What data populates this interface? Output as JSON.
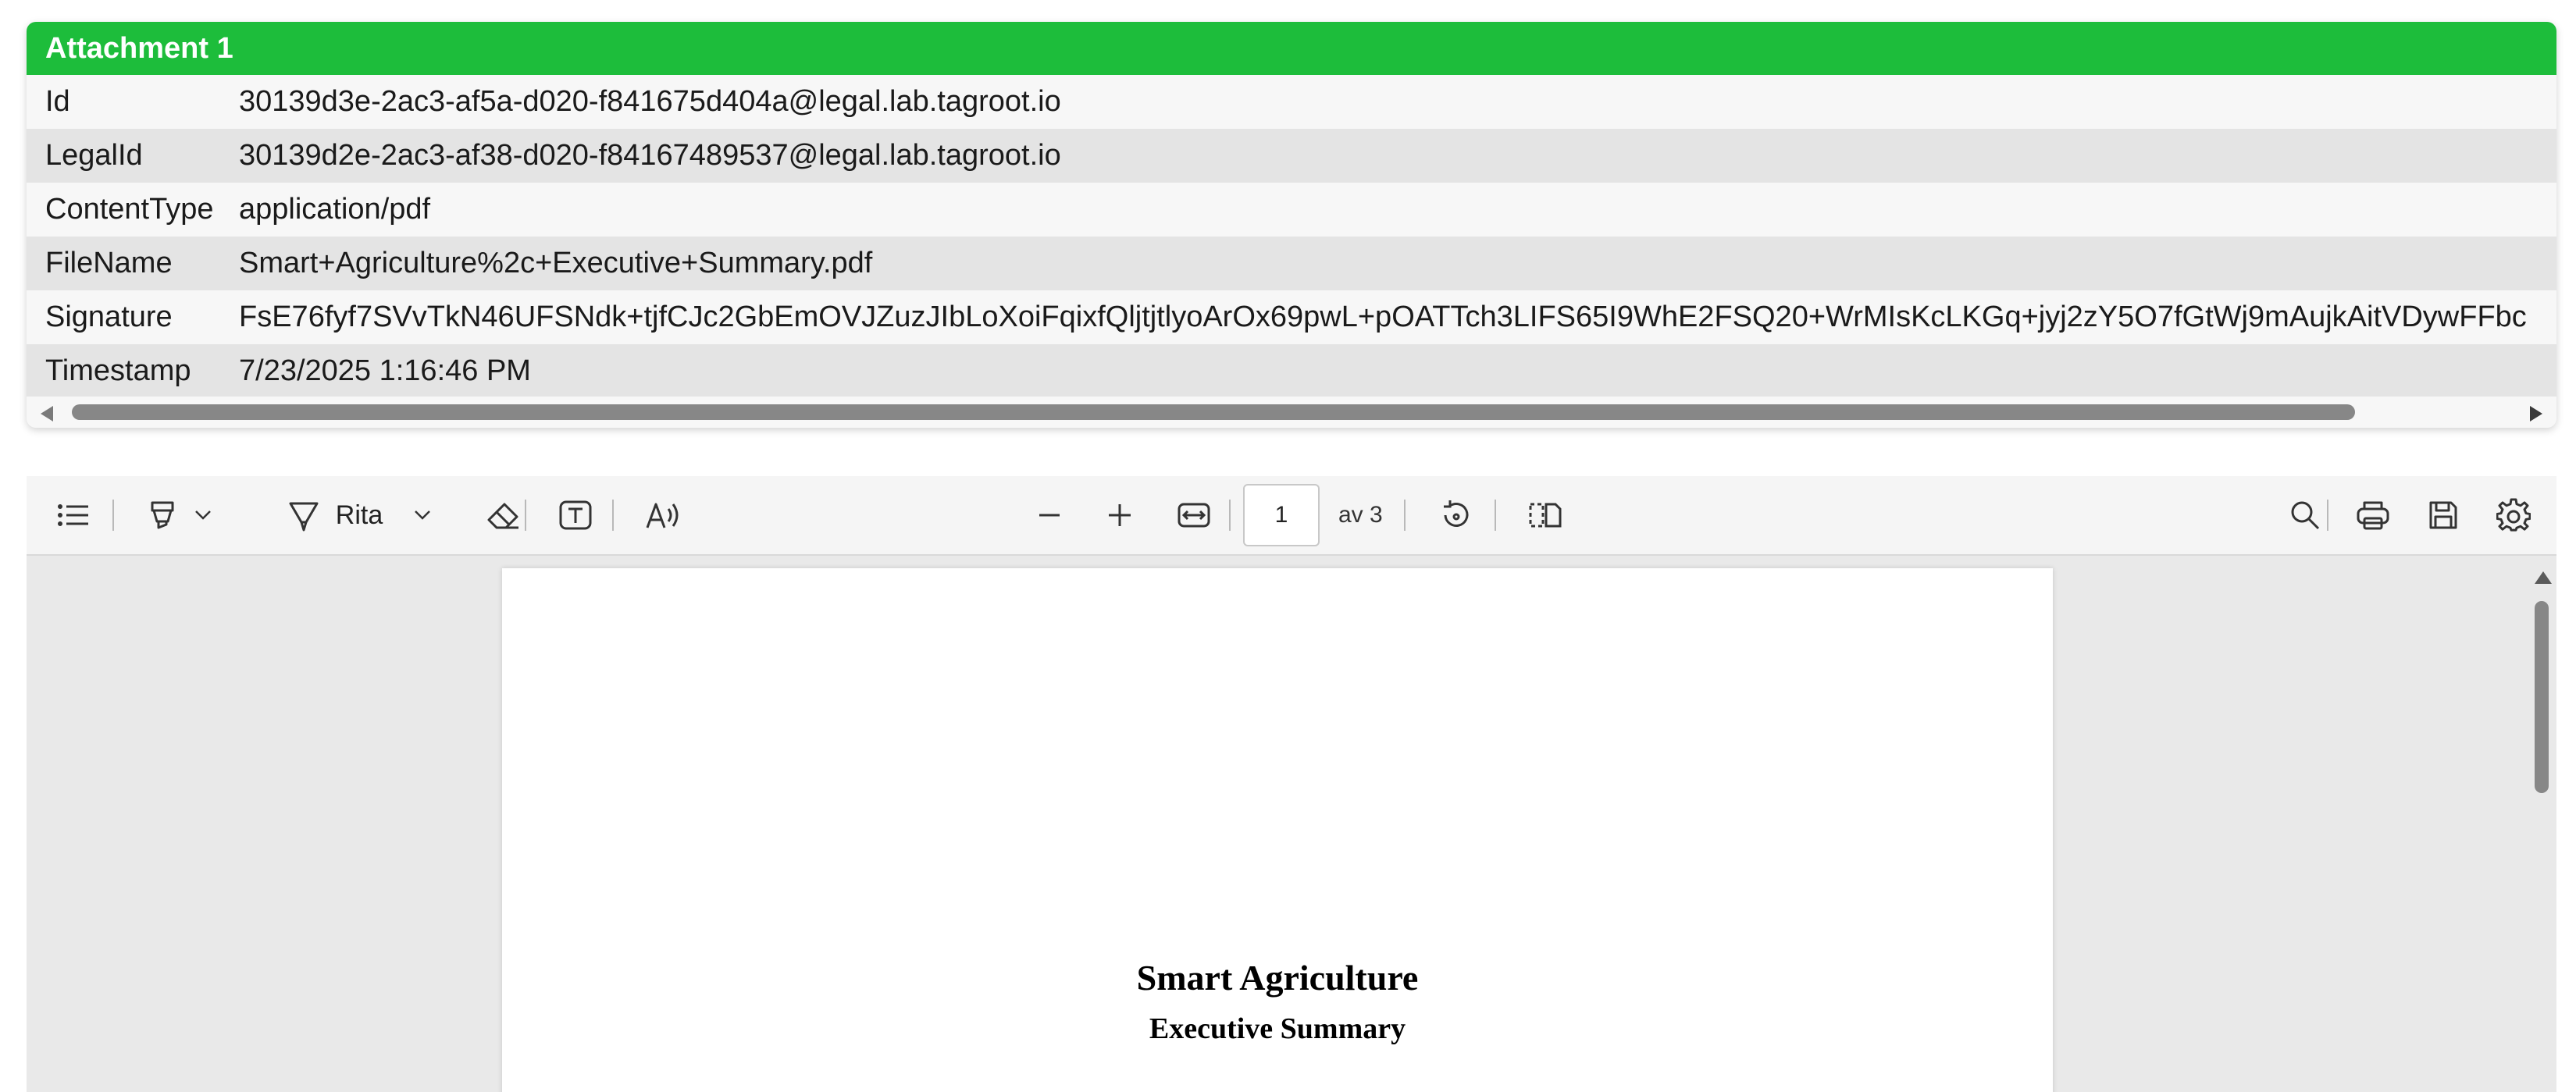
{
  "attachment": {
    "header": "Attachment 1",
    "rows": [
      {
        "key": "Id",
        "value": "30139d3e-2ac3-af5a-d020-f841675d404a@legal.lab.tagroot.io"
      },
      {
        "key": "LegalId",
        "value": "30139d2e-2ac3-af38-d020-f84167489537@legal.lab.tagroot.io"
      },
      {
        "key": "ContentType",
        "value": "application/pdf"
      },
      {
        "key": "FileName",
        "value": "Smart+Agriculture%2c+Executive+Summary.pdf"
      },
      {
        "key": "Signature",
        "value": "FsE76fyf7SVvTkN46UFSNdk+tjfCJc2GbEmOVJZuzJIbLoXoiFqixfQljtjtlyoArOx69pwL+pOATTch3LIFS65I9WhE2FSQ20+WrMIsKcLKGq+jyj2zY5O7fGtWj9mAujkAitVDywFFbc"
      },
      {
        "key": "Timestamp",
        "value": "7/23/2025 1:16:46 PM"
      }
    ]
  },
  "toolbar": {
    "icons": {
      "contents": "list-icon",
      "highlight": "highlighter-icon",
      "draw": "pen-icon",
      "erase": "eraser-icon",
      "text": "text-box-icon",
      "read_aloud": "read-aloud-icon",
      "zoom_out": "minus-icon",
      "zoom_in": "plus-icon",
      "fit_width": "fit-width-icon",
      "rotate": "rotate-icon",
      "page_view": "page-view-icon",
      "search": "search-icon",
      "print": "print-icon",
      "save": "save-icon",
      "settings": "gear-icon"
    },
    "draw_label": "Rita",
    "page_number": "1",
    "page_of": "av 3"
  },
  "document": {
    "title": "Smart Agriculture",
    "subtitle": "Executive Summary"
  },
  "colors": {
    "header_bg": "#1dbd3b",
    "row_odd": "#f7f7f7",
    "row_even": "#e4e4e4",
    "viewer_bg": "#e9e9e9"
  }
}
